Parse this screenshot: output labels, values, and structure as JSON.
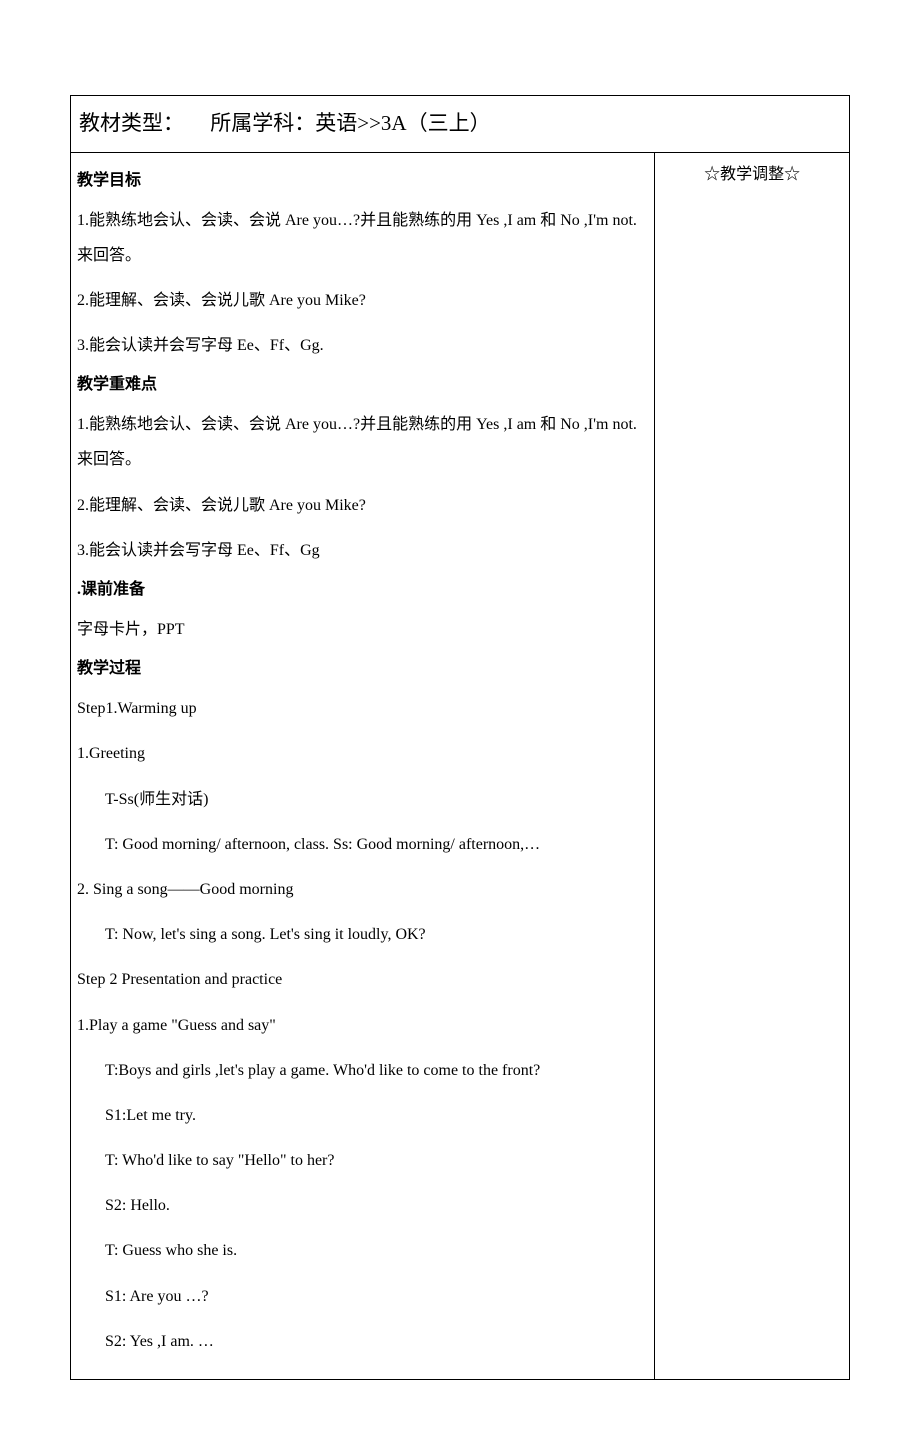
{
  "header": {
    "textbook_type_label": "教材类型：",
    "subject_label": "所属学科：英语>>3A（三上）"
  },
  "sidebar": {
    "title": "☆教学调整☆"
  },
  "sections": {
    "objectives": {
      "heading": "教学目标",
      "items": [
        "1.能熟练地会认、会读、会说 Are you…?并且能熟练的用 Yes ,I am 和  No ,I'm not.来回答。",
        "2.能理解、会读、会说儿歌 Are you Mike?",
        "3.能会认读并会写字母 Ee、Ff、Gg."
      ]
    },
    "key_points": {
      "heading": "教学重难点",
      "items": [
        "1.能熟练地会认、会读、会说 Are you…?并且能熟练的用 Yes ,I am 和  No ,I'm not.来回答。",
        "2.能理解、会读、会说儿歌 Are you Mike?",
        "3.能会认读并会写字母 Ee、Ff、Gg"
      ]
    },
    "preparation": {
      "heading": ".课前准备",
      "content": "字母卡片，PPT"
    },
    "process": {
      "heading": "教学过程",
      "lines": [
        {
          "text": "Step1.Warming up",
          "indent": 0
        },
        {
          "text": "1.Greeting",
          "indent": 0
        },
        {
          "text": "T-Ss(师生对话)",
          "indent": 1
        },
        {
          "text": "T: Good morning/ afternoon, class.      Ss: Good morning/ afternoon,…",
          "indent": 1
        },
        {
          "text": "2. Sing a song——Good morning",
          "indent": 0
        },
        {
          "text": "T: Now, let's sing a song.    Let's sing it loudly, OK?",
          "indent": 1
        },
        {
          "text": "Step 2 Presentation and practice",
          "indent": 0
        },
        {
          "text": "1.Play a game \"Guess and say\"",
          "indent": 0
        },
        {
          "text": "T:Boys and girls ,let's play a game. Who'd like to come to the front?",
          "indent": 1
        },
        {
          "text": "S1:Let me try.",
          "indent": 1
        },
        {
          "text": "T: Who'd like to say \"Hello\" to her?",
          "indent": 1
        },
        {
          "text": "S2: Hello.",
          "indent": 1
        },
        {
          "text": "T: Guess who she is.",
          "indent": 1
        },
        {
          "text": "S1: Are you …?",
          "indent": 1
        },
        {
          "text": "S2: Yes ,I am. …",
          "indent": 1
        }
      ]
    }
  }
}
